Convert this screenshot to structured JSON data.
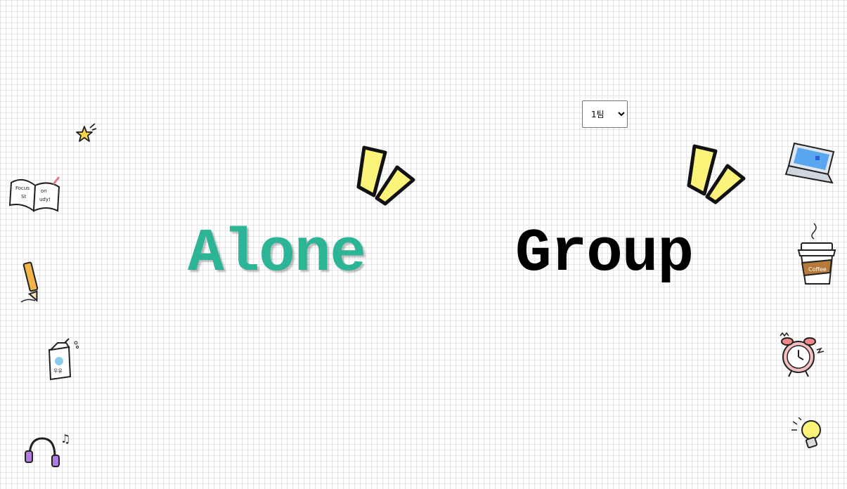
{
  "team_select": {
    "selected": "1팀",
    "options": [
      "1팀"
    ]
  },
  "modes": {
    "alone_label": "Alone",
    "group_label": "Group"
  },
  "colors": {
    "alone_accent": "#2bb596",
    "highlight_yellow": "#fbf37a",
    "grid_line": "#e6e6e6"
  },
  "decorations": {
    "left": [
      "star-icon",
      "open-book-icon",
      "pencil-icon",
      "milk-carton-icon",
      "headphones-icon"
    ],
    "right": [
      "laptop-icon",
      "coffee-cup-icon",
      "alarm-clock-icon",
      "light-bulb-icon"
    ],
    "emphasis": [
      "emphasis-marks-icon"
    ]
  }
}
